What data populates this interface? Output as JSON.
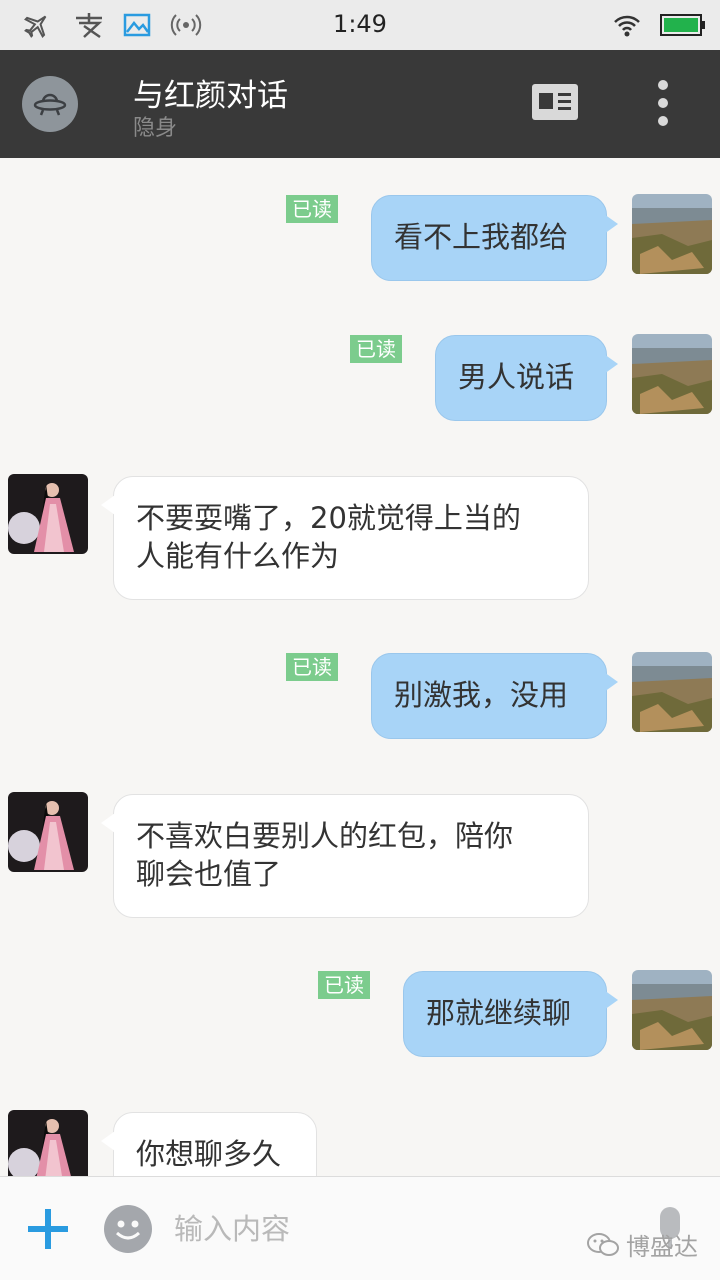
{
  "status_bar": {
    "time": "1:49",
    "icons": [
      "airplane-icon",
      "alipay-icon",
      "gallery-icon",
      "hotspot-icon",
      "wifi-icon",
      "battery-icon"
    ],
    "battery_color": "#22b24c"
  },
  "header": {
    "title": "与红颜对话",
    "subtitle": "隐身"
  },
  "messages": [
    {
      "direction": "out",
      "text": "看不上我都给",
      "read_label": "已读"
    },
    {
      "direction": "out",
      "text": "男人说话",
      "read_label": "已读"
    },
    {
      "direction": "in",
      "line1": "不要耍嘴了，20就觉得上当的",
      "line2": "人能有什么作为"
    },
    {
      "direction": "out",
      "text": "别激我，没用",
      "read_label": "已读"
    },
    {
      "direction": "in",
      "line1": "不喜欢白要别人的红包，陪你",
      "line2": "聊会也值了"
    },
    {
      "direction": "out",
      "text": "那就继续聊",
      "read_label": "已读"
    },
    {
      "direction": "in",
      "text": "你想聊多久"
    }
  ],
  "input_bar": {
    "placeholder": "输入内容",
    "watermark": "博盛达"
  },
  "colors": {
    "header_bg": "#393939",
    "outgoing_bubble": "#a8d4f7",
    "incoming_bubble": "#ffffff",
    "read_badge": "#7ccc8d",
    "accent_plus": "#2a9be0"
  }
}
